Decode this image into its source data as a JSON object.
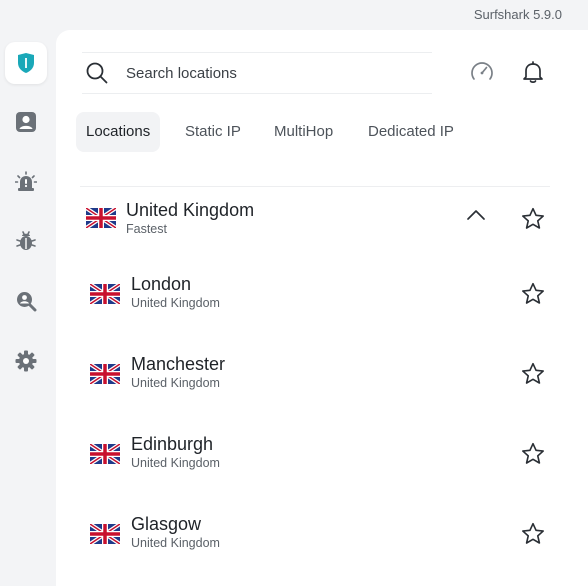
{
  "app": {
    "version_label": "Surfshark 5.9.0"
  },
  "sidebar": {
    "items": [
      {
        "icon": "shield-icon",
        "active": true
      },
      {
        "icon": "user-icon",
        "active": false
      },
      {
        "icon": "alert-icon",
        "active": false
      },
      {
        "icon": "bug-icon",
        "active": false
      },
      {
        "icon": "search-person-icon",
        "active": false
      },
      {
        "icon": "gear-icon",
        "active": false
      }
    ]
  },
  "search": {
    "placeholder": "Search locations",
    "value": ""
  },
  "header_icons": {
    "speed": "speedometer-icon",
    "notifications": "bell-icon"
  },
  "tabs": [
    {
      "label": "Locations",
      "active": true
    },
    {
      "label": "Static IP",
      "active": false
    },
    {
      "label": "MultiHop",
      "active": false
    },
    {
      "label": "Dedicated IP",
      "active": false
    }
  ],
  "country": {
    "name": "United Kingdom",
    "subtitle": "Fastest",
    "expanded": true
  },
  "cities": [
    {
      "name": "London",
      "country": "United Kingdom"
    },
    {
      "name": "Manchester",
      "country": "United Kingdom"
    },
    {
      "name": "Edinburgh",
      "country": "United Kingdom"
    },
    {
      "name": "Glasgow",
      "country": "United Kingdom"
    }
  ],
  "colors": {
    "accent": "#1aa8b8",
    "sidebar_icon": "#6b7178",
    "text": "#1f2328",
    "muted": "#5b6168"
  }
}
